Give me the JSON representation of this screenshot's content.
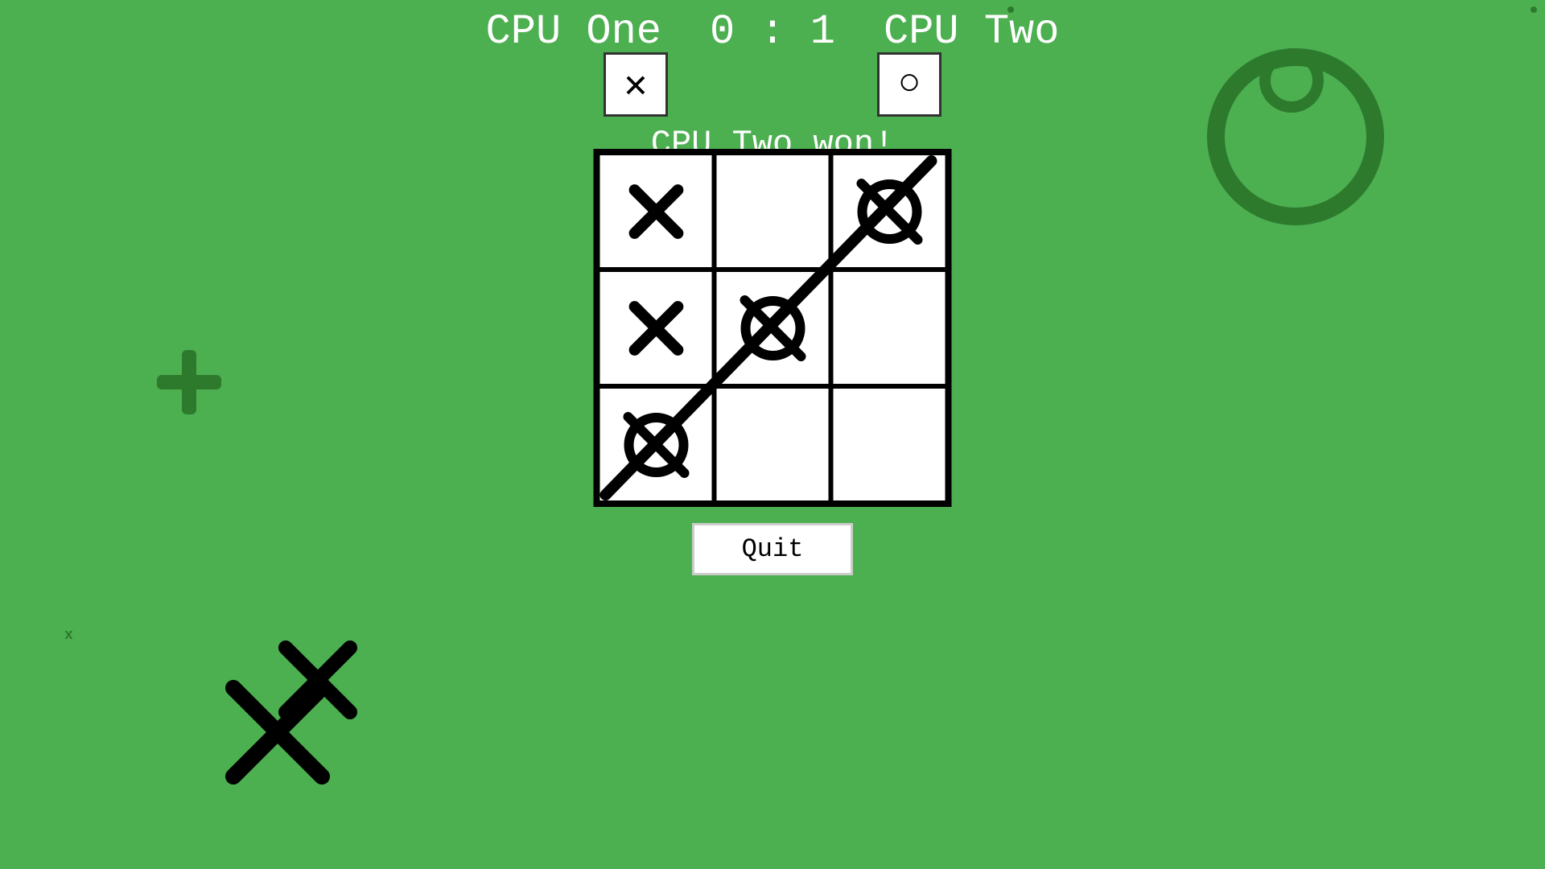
{
  "header": {
    "player1_name": "CPU One",
    "score": "0 : 1",
    "player2_name": "CPU Two"
  },
  "player1_icon": "✕",
  "player2_icon": "○",
  "win_message": "CPU Two won!",
  "board": {
    "cells": [
      {
        "type": "X",
        "row": 0,
        "col": 0
      },
      {
        "type": "",
        "row": 0,
        "col": 1
      },
      {
        "type": "O_struck",
        "row": 0,
        "col": 2
      },
      {
        "type": "X",
        "row": 1,
        "col": 0
      },
      {
        "type": "O_struck",
        "row": 1,
        "col": 1
      },
      {
        "type": "",
        "row": 1,
        "col": 2
      },
      {
        "type": "O_struck",
        "row": 2,
        "col": 0
      },
      {
        "type": "",
        "row": 2,
        "col": 1
      },
      {
        "type": "",
        "row": 2,
        "col": 2
      }
    ]
  },
  "quit_button_label": "Quit",
  "score_display": {
    "cpu_one_score": 0,
    "cpu_two_score": 1,
    "separator": ":"
  }
}
